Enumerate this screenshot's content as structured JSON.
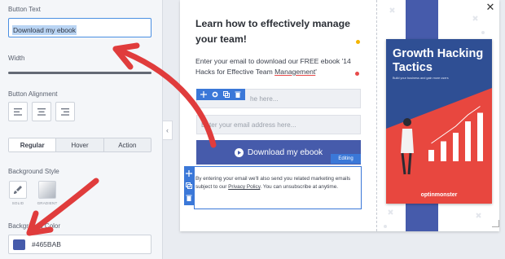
{
  "sidebar": {
    "button_text_label": "Button Text",
    "button_text_value": "Download my ebook",
    "width_label": "Width",
    "alignment_label": "Button Alignment",
    "state_tabs": [
      {
        "label": "Regular"
      },
      {
        "label": "Hover"
      },
      {
        "label": "Action"
      }
    ],
    "bg_style_label": "Background Style",
    "bg_styles": [
      {
        "caption": "SOLID",
        "icon": "paint-brush-icon"
      },
      {
        "caption": "GRADIENT",
        "icon": "gradient-icon"
      }
    ],
    "bg_color_label": "Background Color",
    "bg_color_value": "#465BAB"
  },
  "popup": {
    "headline": "Learn how to effectively manage your team!",
    "subtext_prefix": "Enter your email to download our FREE ebook '14 Hacks for Effective Team ",
    "subtext_underlined": "Management",
    "subtext_suffix": "'",
    "name_placeholder": "he here...",
    "email_placeholder": "Enter your email address here...",
    "cta_label": "Download my ebook",
    "editing_badge": "Editing",
    "disclaimer_prefix": "By entering your email we'll also send you related marketing emails subject to our ",
    "disclaimer_link": "Privacy Policy",
    "disclaimer_suffix": ". You can unsubscribe at anytime.",
    "close_label": "✕"
  },
  "book": {
    "title": "Growth Hacking Tactics",
    "subtitle": "Build your business and gain more users",
    "logo": "optinmonster",
    "bar_heights": [
      0.2,
      0.35,
      0.5,
      0.7,
      0.85
    ]
  },
  "colors": {
    "accent_blue": "#465BAB",
    "editor_blue": "#3b78d8",
    "arrow_red": "#e03c3c",
    "book_red": "#e8473f"
  }
}
